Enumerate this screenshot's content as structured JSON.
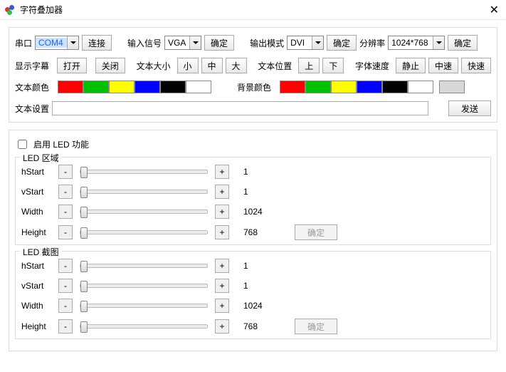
{
  "window": {
    "title": "字符叠加器",
    "close": "✕"
  },
  "top": {
    "port_label": "串口",
    "port_value": "COM4",
    "connect": "连接",
    "input_label": "输入信号",
    "input_value": "VGA",
    "confirm": "确定",
    "output_label": "输出模式",
    "output_value": "DVI",
    "res_label": "分辨率",
    "res_value": "1024*768"
  },
  "sub": {
    "show_sub": "显示字幕",
    "open": "打开",
    "close": "关闭",
    "size_label": "文本大小",
    "size_s": "小",
    "size_m": "中",
    "size_l": "大",
    "pos_label": "文本位置",
    "pos_up": "上",
    "pos_dn": "下",
    "speed_label": "字体速度",
    "speed_0": "静止",
    "speed_1": "中速",
    "speed_2": "快速"
  },
  "color": {
    "text_label": "文本颜色",
    "bg_label": "背景颜色",
    "swatches": [
      "#ff0000",
      "#00c000",
      "#ffff00",
      "#0000ff",
      "#000000",
      "#ffffff"
    ],
    "bg_extra": "#d8d8d8"
  },
  "text": {
    "label": "文本设置",
    "value": "",
    "send": "发送"
  },
  "led": {
    "enable": "启用 LED 功能",
    "area_title": "LED 区域",
    "shot_title": "LED 截图",
    "rows": [
      {
        "name": "hStart",
        "val": "1"
      },
      {
        "name": "vStart",
        "val": "1"
      },
      {
        "name": "Width",
        "val": "1024"
      },
      {
        "name": "Height",
        "val": "768"
      }
    ],
    "confirm": "确定"
  }
}
